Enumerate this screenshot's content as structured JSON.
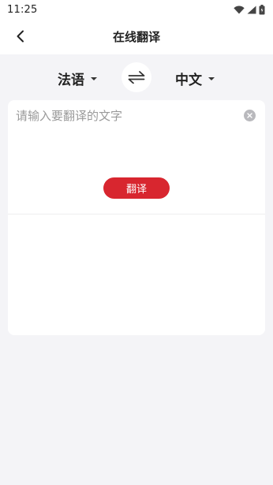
{
  "status_bar": {
    "time": "11:25",
    "icons": [
      "wifi-icon",
      "cellular-signal-icon",
      "battery-icon"
    ]
  },
  "header": {
    "title": "在线翻译",
    "back_icon": "chevron-left-icon"
  },
  "languages": {
    "source": "法语",
    "target": "中文",
    "swap_icon": "swap-arrows-icon"
  },
  "input": {
    "value": "",
    "placeholder": "请输入要翻译的文字",
    "clear_icon": "clear-circle-icon"
  },
  "translate_button": {
    "label": "翻译"
  },
  "output": {
    "text": ""
  },
  "colors": {
    "accent": "#d8262f",
    "background": "#f4f4f7",
    "card": "#ffffff"
  }
}
